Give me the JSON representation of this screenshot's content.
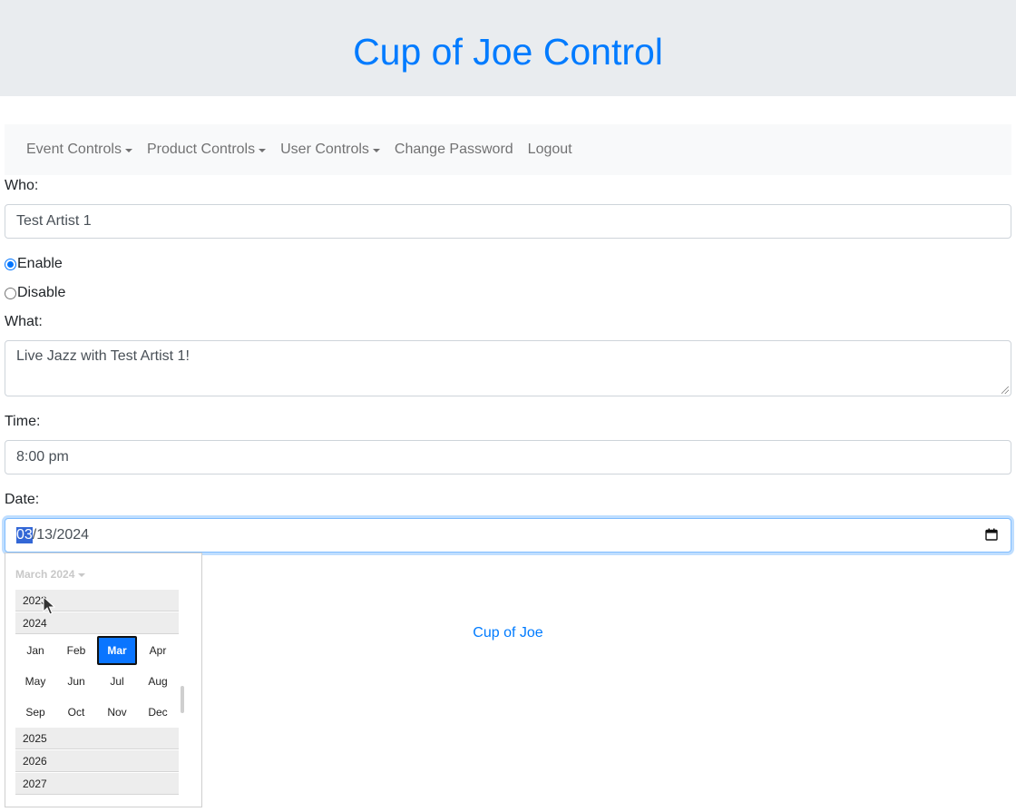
{
  "header": {
    "title": "Cup of Joe Control"
  },
  "nav": {
    "items": [
      {
        "label": "Event Controls",
        "dropdown": true
      },
      {
        "label": "Product Controls",
        "dropdown": true
      },
      {
        "label": "User Controls",
        "dropdown": true
      },
      {
        "label": "Change Password",
        "dropdown": false
      },
      {
        "label": "Logout",
        "dropdown": false
      }
    ]
  },
  "form": {
    "who_label": "Who:",
    "who_value": "Test Artist 1",
    "enable_label": "Enable",
    "disable_label": "Disable",
    "enabled": true,
    "what_label": "What:",
    "what_value": "Live Jazz with Test Artist 1!",
    "time_label": "Time:",
    "time_value": "8:00 pm",
    "date_label": "Date:",
    "date_month": "03",
    "date_rest": "/13/2024"
  },
  "footer": {
    "link": "Cup of Joe"
  },
  "picker": {
    "header": "March 2024",
    "years_before": [
      "2023",
      "2024"
    ],
    "months": [
      "Jan",
      "Feb",
      "Mar",
      "Apr",
      "May",
      "Jun",
      "Jul",
      "Aug",
      "Sep",
      "Oct",
      "Nov",
      "Dec"
    ],
    "selected_month": "Mar",
    "years_after": [
      "2025",
      "2026",
      "2027"
    ]
  },
  "colors": {
    "accent": "#007bff",
    "header_bg": "#e9ecef",
    "nav_bg": "#f8f9fa",
    "selected_month": "#0a75ff"
  }
}
